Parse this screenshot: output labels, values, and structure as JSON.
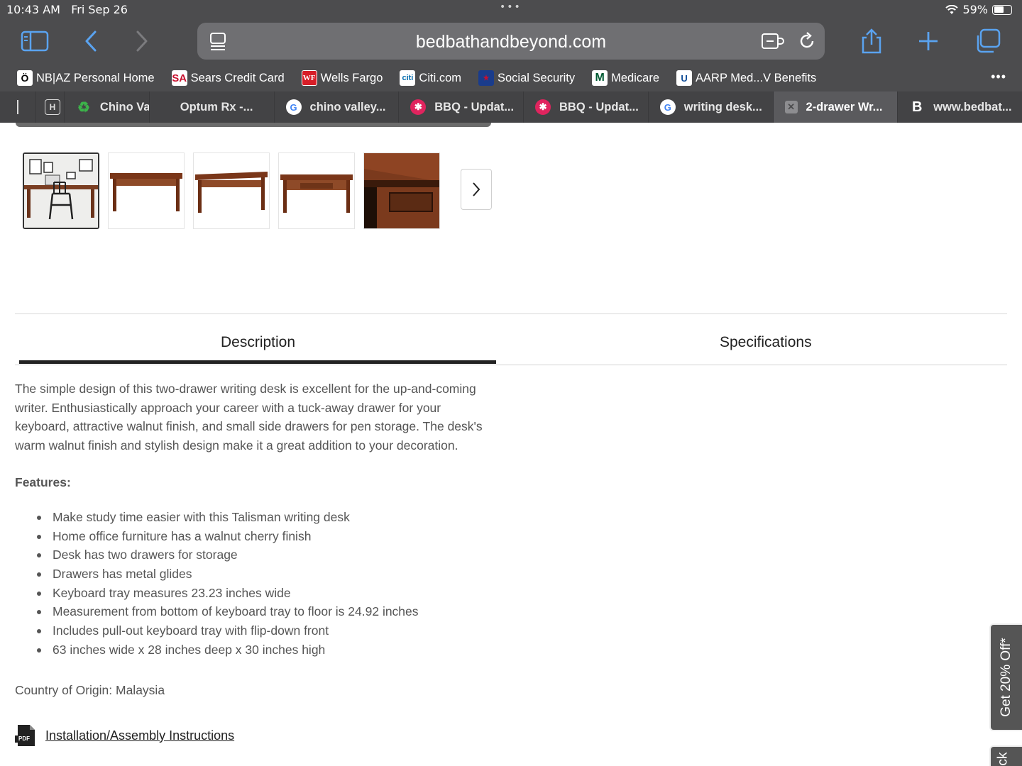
{
  "status": {
    "time": "10:43 AM",
    "date": "Fri Sep 26",
    "battery": "59%",
    "battery_level": 0.59
  },
  "browser": {
    "url": "bedbathandbeyond.com",
    "bookmarks": [
      {
        "label": "NB|AZ Personal Home",
        "icon": "nb-icon"
      },
      {
        "label": "Sears Credit Card",
        "icon": "sa-icon"
      },
      {
        "label": "Wells Fargo",
        "icon": "wf-icon"
      },
      {
        "label": "Citi.com",
        "icon": "citi-icon"
      },
      {
        "label": "Social Security",
        "icon": "ssa-icon"
      },
      {
        "label": "Medicare",
        "icon": "medicare-icon"
      },
      {
        "label": "AARP Med...V Benefits",
        "icon": "aarp-icon"
      }
    ],
    "tabs": [
      {
        "label": ""
      },
      {
        "label": "Chino Va",
        "icon": "recycle-icon"
      },
      {
        "label": "Optum Rx -..."
      },
      {
        "label": "chino valley...",
        "icon": "google-icon"
      },
      {
        "label": "BBQ - Updat...",
        "icon": "yelp-icon"
      },
      {
        "label": "BBQ - Updat...",
        "icon": "yelp-icon"
      },
      {
        "label": "writing desk...",
        "icon": "google-icon"
      },
      {
        "label": "2-drawer Wr...",
        "icon": "close-icon",
        "active": true
      },
      {
        "label": "www.bedbat...",
        "icon": "bedbath-icon"
      }
    ]
  },
  "product": {
    "tabs": {
      "description": "Description",
      "specifications": "Specifications"
    },
    "description": "The simple design of this two-drawer writing desk is excellent for the up-and-coming writer. Enthusiastically approach your career with a tuck-away drawer for your keyboard, attractive walnut finish, and small side drawers for pen storage. The desk's warm walnut finish and stylish design make it a great addition to your decoration.",
    "features_title": "Features:",
    "features": [
      "Make study time easier with this Talisman writing desk",
      "Home office furniture has a walnut cherry finish",
      "Desk has two drawers for storage",
      "Drawers has metal glides",
      "Keyboard tray measures 23.23 inches wide",
      "Measurement from bottom of keyboard tray to floor is 24.92 inches",
      "Includes pull-out keyboard tray with flip-down front",
      "63 inches wide x 28 inches deep x 30 inches high"
    ],
    "origin": "Country of Origin: Malaysia",
    "pdf_label": "PDF",
    "install_link": "Installation/Assembly Instructions"
  },
  "promo": {
    "label": "Get 20% Off*",
    "label2": "ck"
  }
}
